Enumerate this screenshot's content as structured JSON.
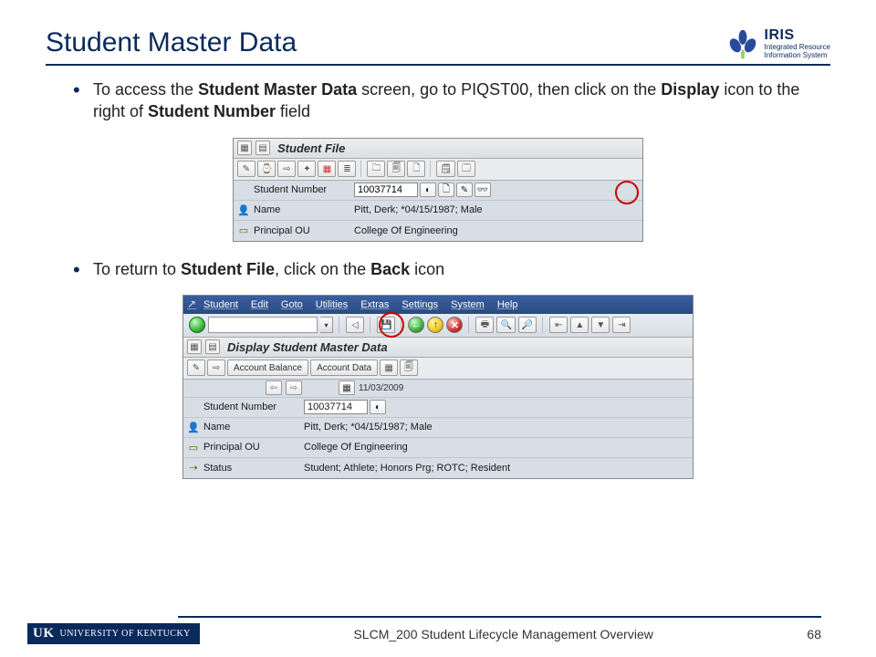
{
  "header": {
    "title": "Student Master Data",
    "logo_main": "IRIS",
    "logo_sub1": "Integrated Resource",
    "logo_sub2": "Information System"
  },
  "bullets": {
    "b1_pre": "To access the ",
    "b1_s1": "Student Master Data",
    "b1_mid1": " screen, go to PIQST00, then click on the ",
    "b1_s2": "Display",
    "b1_mid2": " icon to the right of ",
    "b1_s3": "Student Number",
    "b1_post": " field",
    "b2_pre": "To return to ",
    "b2_s1": "Student File",
    "b2_mid": ", click on the ",
    "b2_s2": "Back",
    "b2_post": " icon"
  },
  "shot1": {
    "title": "Student File",
    "rows": {
      "student_number_label": "Student Number",
      "student_number_value": "10037714",
      "name_label": "Name",
      "name_value": "Pitt, Derk; *04/15/1987; Male",
      "principal_label": "Principal OU",
      "principal_value": "College Of Engineering"
    }
  },
  "shot2": {
    "menu": [
      "Student",
      "Edit",
      "Goto",
      "Utilities",
      "Extras",
      "Settings",
      "System",
      "Help"
    ],
    "title": "Display Student Master Data",
    "buttons": {
      "acct_balance": "Account Balance",
      "acct_data": "Account Data"
    },
    "date": "11/03/2009",
    "rows": {
      "student_number_label": "Student Number",
      "student_number_value": "10037714",
      "name_label": "Name",
      "name_value": "Pitt, Derk; *04/15/1987; Male",
      "principal_label": "Principal OU",
      "principal_value": "College Of Engineering",
      "status_label": "Status",
      "status_value": "Student; Athlete; Honors Prg; ROTC; Resident"
    }
  },
  "footer": {
    "badge_uk": "UK",
    "badge_text": "UNIVERSITY OF KENTUCKY",
    "center": "SLCM_200 Student Lifecycle Management Overview",
    "page": "68"
  }
}
